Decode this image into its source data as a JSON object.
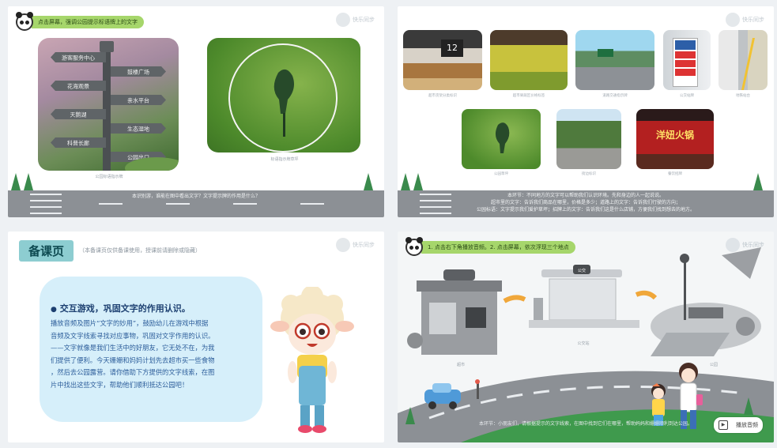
{
  "slide1": {
    "instruction": "点击屏幕，强调公园提示标语牌上的文字",
    "logo": "快乐同步",
    "signs": [
      "游客服务中心",
      "鼓楼广场",
      "花海观景",
      "亲水平台",
      "天鹅湖",
      "生态湿地",
      "科普长廊",
      "公园出口"
    ],
    "caption_left": "公园标语指示牌",
    "caption_right": "标语指示牌草坪",
    "bottom_note": "本识别游，谁能在图中看出文字？文字提示牌的作用是什么？"
  },
  "slide2": {
    "logo": "快乐同步",
    "thumbs": [
      {
        "name": "thumb-supermarket-aisle",
        "caption": "超市货架分类标识",
        "text": "12"
      },
      {
        "name": "thumb-produce-section",
        "caption": "超市果蔬区价格标签",
        "text": ""
      },
      {
        "name": "thumb-highway-sign",
        "caption": "道路交通指示牌",
        "text": ""
      },
      {
        "name": "thumb-bus-stop-sign",
        "caption": "公交站牌",
        "text": ""
      },
      {
        "name": "thumb-subway-platform",
        "caption": "地铁站台",
        "text": ""
      },
      {
        "name": "thumb-lawn-sign",
        "caption": "公园草坪",
        "text": ""
      },
      {
        "name": "thumb-street",
        "caption": "街边标识",
        "text": ""
      },
      {
        "name": "thumb-hotpot-storefront",
        "caption": "餐饮招牌",
        "text": "洋妞火锅"
      }
    ],
    "note_lines": [
      "本环节：不同地方的文字可以帮助我们认识环境。先和身边的人一起说说。",
      "超市里的文字：告诉我们商品在哪里，价格是多少；道路上的文字：告诉我们行驶的方向；",
      "公园标语：文字提示我们爱护草坪；招牌上的文字：告诉我们这是什么店铺，方便我们找到想去的地方。"
    ]
  },
  "slide3": {
    "header": "备课页",
    "header_note": "（本备课页仅供备课使用，授课前请删除或隐藏）",
    "logo": "快乐同步",
    "card_title": "交互游戏，巩固文字的作用认识。",
    "card_body": [
      "播放音频及图片“文字的妙用”，鼓励幼儿在游戏中根据",
      "音频及文字线索寻找对应事物，巩固对文字作用的认识。",
      "——文字就像是我们生活中的好朋友，它无处不在，为我",
      "们提供了便利。今天姗姗和妈妈计划先去超市买一些食物",
      "，然后去公园露营。请你借助下方提供的文字线索，在图",
      "片中找出这些文字，帮助他们顺利抵达公园吧！"
    ]
  },
  "slide4": {
    "instruction": "1. 点击右下角播放音频。2. 点击屏幕，依次浮现三个地点",
    "logo": "快乐同步",
    "places": [
      "超市",
      "公交站",
      "公园"
    ],
    "bus_sign": "公交",
    "note": "本环节：小朋友们，请根据提示的文字线索，在图中找到它们在哪里，帮助妈妈和姗姗顺利到达公园。",
    "play_button": "播放音频"
  },
  "colors": {
    "accent_green": "#a6d66b",
    "road": "#8c9095",
    "card_bg": "#d6effa",
    "header_bg": "#8dcdd1"
  }
}
